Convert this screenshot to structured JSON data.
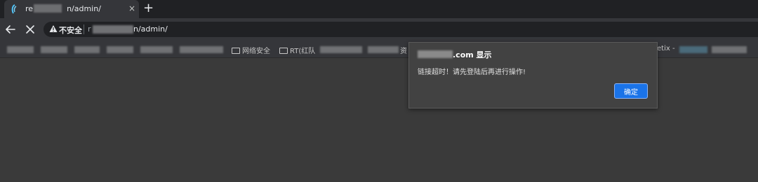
{
  "tab": {
    "title_prefix": "re",
    "title_suffix": "n/admin/",
    "close_label": "×"
  },
  "newtab_label": "+",
  "toolbar": {
    "security_label": "不安全",
    "url_prefix": "r",
    "url_path": "n/admin/"
  },
  "bookmarks": {
    "items": [
      {
        "label": "网络安全"
      },
      {
        "label": "RT(红队"
      },
      {
        "label": "资"
      },
      {
        "label": "etix -"
      }
    ]
  },
  "dialog": {
    "origin_suffix": ".com 显示",
    "message": "链接超时！请先登陆后再进行操作!",
    "ok_label": "确定"
  },
  "colors": {
    "tab_bg": "#35363a",
    "titlebar_bg": "#202124",
    "page_bg": "#3a3a3a",
    "dialog_bg": "#424242",
    "button_blue": "#1a73e8"
  }
}
